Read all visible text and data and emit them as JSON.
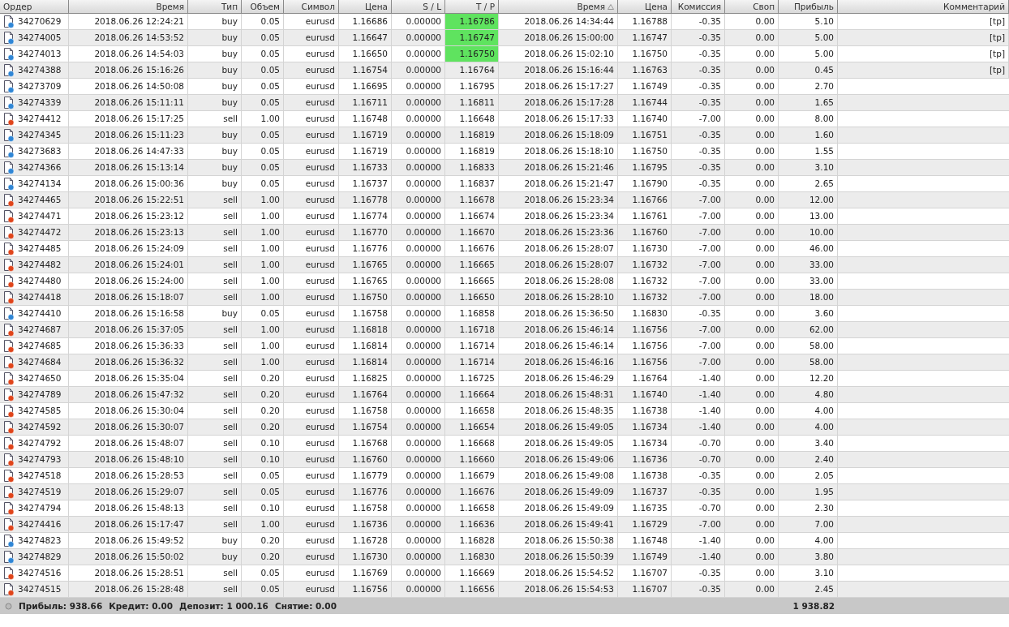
{
  "columns": [
    {
      "label": "Ордер",
      "sorted": false
    },
    {
      "label": "Время",
      "sorted": false
    },
    {
      "label": "Тип",
      "sorted": false
    },
    {
      "label": "Объем",
      "sorted": false
    },
    {
      "label": "Символ",
      "sorted": false
    },
    {
      "label": "Цена",
      "sorted": false
    },
    {
      "label": "S / L",
      "sorted": false
    },
    {
      "label": "T / P",
      "sorted": false
    },
    {
      "label": "Время",
      "sorted": true
    },
    {
      "label": "Цена",
      "sorted": false
    },
    {
      "label": "Комиссия",
      "sorted": false
    },
    {
      "label": "Своп",
      "sorted": false
    },
    {
      "label": "Прибыль",
      "sorted": false
    },
    {
      "label": "Комментарий",
      "sorted": false
    }
  ],
  "rows": [
    {
      "kind": "buy",
      "tp_hit": true,
      "cells": [
        "34270629",
        "2018.06.26 12:24:21",
        "buy",
        "0.05",
        "eurusd",
        "1.16686",
        "0.00000",
        "1.16786",
        "2018.06.26 14:34:44",
        "1.16788",
        "-0.35",
        "0.00",
        "5.10",
        "[tp]"
      ]
    },
    {
      "kind": "buy",
      "tp_hit": true,
      "cells": [
        "34274005",
        "2018.06.26 14:53:52",
        "buy",
        "0.05",
        "eurusd",
        "1.16647",
        "0.00000",
        "1.16747",
        "2018.06.26 15:00:00",
        "1.16747",
        "-0.35",
        "0.00",
        "5.00",
        "[tp]"
      ]
    },
    {
      "kind": "buy",
      "tp_hit": true,
      "cells": [
        "34274013",
        "2018.06.26 14:54:03",
        "buy",
        "0.05",
        "eurusd",
        "1.16650",
        "0.00000",
        "1.16750",
        "2018.06.26 15:02:10",
        "1.16750",
        "-0.35",
        "0.00",
        "5.00",
        "[tp]"
      ]
    },
    {
      "kind": "buy",
      "tp_hit": false,
      "cells": [
        "34274388",
        "2018.06.26 15:16:26",
        "buy",
        "0.05",
        "eurusd",
        "1.16754",
        "0.00000",
        "1.16764",
        "2018.06.26 15:16:44",
        "1.16763",
        "-0.35",
        "0.00",
        "0.45",
        "[tp]"
      ]
    },
    {
      "kind": "buy",
      "tp_hit": false,
      "cells": [
        "34273709",
        "2018.06.26 14:50:08",
        "buy",
        "0.05",
        "eurusd",
        "1.16695",
        "0.00000",
        "1.16795",
        "2018.06.26 15:17:27",
        "1.16749",
        "-0.35",
        "0.00",
        "2.70"
      ]
    },
    {
      "kind": "buy",
      "tp_hit": false,
      "cells": [
        "34274339",
        "2018.06.26 15:11:11",
        "buy",
        "0.05",
        "eurusd",
        "1.16711",
        "0.00000",
        "1.16811",
        "2018.06.26 15:17:28",
        "1.16744",
        "-0.35",
        "0.00",
        "1.65"
      ]
    },
    {
      "kind": "sell",
      "tp_hit": false,
      "cells": [
        "34274412",
        "2018.06.26 15:17:25",
        "sell",
        "1.00",
        "eurusd",
        "1.16748",
        "0.00000",
        "1.16648",
        "2018.06.26 15:17:33",
        "1.16740",
        "-7.00",
        "0.00",
        "8.00"
      ]
    },
    {
      "kind": "buy",
      "tp_hit": false,
      "cells": [
        "34274345",
        "2018.06.26 15:11:23",
        "buy",
        "0.05",
        "eurusd",
        "1.16719",
        "0.00000",
        "1.16819",
        "2018.06.26 15:18:09",
        "1.16751",
        "-0.35",
        "0.00",
        "1.60"
      ]
    },
    {
      "kind": "buy",
      "tp_hit": false,
      "cells": [
        "34273683",
        "2018.06.26 14:47:33",
        "buy",
        "0.05",
        "eurusd",
        "1.16719",
        "0.00000",
        "1.16819",
        "2018.06.26 15:18:10",
        "1.16750",
        "-0.35",
        "0.00",
        "1.55"
      ]
    },
    {
      "kind": "buy",
      "tp_hit": false,
      "cells": [
        "34274366",
        "2018.06.26 15:13:14",
        "buy",
        "0.05",
        "eurusd",
        "1.16733",
        "0.00000",
        "1.16833",
        "2018.06.26 15:21:46",
        "1.16795",
        "-0.35",
        "0.00",
        "3.10"
      ]
    },
    {
      "kind": "buy",
      "tp_hit": false,
      "cells": [
        "34274134",
        "2018.06.26 15:00:36",
        "buy",
        "0.05",
        "eurusd",
        "1.16737",
        "0.00000",
        "1.16837",
        "2018.06.26 15:21:47",
        "1.16790",
        "-0.35",
        "0.00",
        "2.65"
      ]
    },
    {
      "kind": "sell",
      "tp_hit": false,
      "cells": [
        "34274465",
        "2018.06.26 15:22:51",
        "sell",
        "1.00",
        "eurusd",
        "1.16778",
        "0.00000",
        "1.16678",
        "2018.06.26 15:23:34",
        "1.16766",
        "-7.00",
        "0.00",
        "12.00"
      ]
    },
    {
      "kind": "sell",
      "tp_hit": false,
      "cells": [
        "34274471",
        "2018.06.26 15:23:12",
        "sell",
        "1.00",
        "eurusd",
        "1.16774",
        "0.00000",
        "1.16674",
        "2018.06.26 15:23:34",
        "1.16761",
        "-7.00",
        "0.00",
        "13.00"
      ]
    },
    {
      "kind": "sell",
      "tp_hit": false,
      "cells": [
        "34274472",
        "2018.06.26 15:23:13",
        "sell",
        "1.00",
        "eurusd",
        "1.16770",
        "0.00000",
        "1.16670",
        "2018.06.26 15:23:36",
        "1.16760",
        "-7.00",
        "0.00",
        "10.00"
      ]
    },
    {
      "kind": "sell",
      "tp_hit": false,
      "cells": [
        "34274485",
        "2018.06.26 15:24:09",
        "sell",
        "1.00",
        "eurusd",
        "1.16776",
        "0.00000",
        "1.16676",
        "2018.06.26 15:28:07",
        "1.16730",
        "-7.00",
        "0.00",
        "46.00"
      ]
    },
    {
      "kind": "sell",
      "tp_hit": false,
      "cells": [
        "34274482",
        "2018.06.26 15:24:01",
        "sell",
        "1.00",
        "eurusd",
        "1.16765",
        "0.00000",
        "1.16665",
        "2018.06.26 15:28:07",
        "1.16732",
        "-7.00",
        "0.00",
        "33.00"
      ]
    },
    {
      "kind": "sell",
      "tp_hit": false,
      "cells": [
        "34274480",
        "2018.06.26 15:24:00",
        "sell",
        "1.00",
        "eurusd",
        "1.16765",
        "0.00000",
        "1.16665",
        "2018.06.26 15:28:08",
        "1.16732",
        "-7.00",
        "0.00",
        "33.00"
      ]
    },
    {
      "kind": "sell",
      "tp_hit": false,
      "cells": [
        "34274418",
        "2018.06.26 15:18:07",
        "sell",
        "1.00",
        "eurusd",
        "1.16750",
        "0.00000",
        "1.16650",
        "2018.06.26 15:28:10",
        "1.16732",
        "-7.00",
        "0.00",
        "18.00"
      ]
    },
    {
      "kind": "buy",
      "tp_hit": false,
      "cells": [
        "34274410",
        "2018.06.26 15:16:58",
        "buy",
        "0.05",
        "eurusd",
        "1.16758",
        "0.00000",
        "1.16858",
        "2018.06.26 15:36:50",
        "1.16830",
        "-0.35",
        "0.00",
        "3.60"
      ]
    },
    {
      "kind": "sell",
      "tp_hit": false,
      "cells": [
        "34274687",
        "2018.06.26 15:37:05",
        "sell",
        "1.00",
        "eurusd",
        "1.16818",
        "0.00000",
        "1.16718",
        "2018.06.26 15:46:14",
        "1.16756",
        "-7.00",
        "0.00",
        "62.00"
      ]
    },
    {
      "kind": "sell",
      "tp_hit": false,
      "cells": [
        "34274685",
        "2018.06.26 15:36:33",
        "sell",
        "1.00",
        "eurusd",
        "1.16814",
        "0.00000",
        "1.16714",
        "2018.06.26 15:46:14",
        "1.16756",
        "-7.00",
        "0.00",
        "58.00"
      ]
    },
    {
      "kind": "sell",
      "tp_hit": false,
      "cells": [
        "34274684",
        "2018.06.26 15:36:32",
        "sell",
        "1.00",
        "eurusd",
        "1.16814",
        "0.00000",
        "1.16714",
        "2018.06.26 15:46:16",
        "1.16756",
        "-7.00",
        "0.00",
        "58.00"
      ]
    },
    {
      "kind": "sell",
      "tp_hit": false,
      "cells": [
        "34274650",
        "2018.06.26 15:35:04",
        "sell",
        "0.20",
        "eurusd",
        "1.16825",
        "0.00000",
        "1.16725",
        "2018.06.26 15:46:29",
        "1.16764",
        "-1.40",
        "0.00",
        "12.20"
      ]
    },
    {
      "kind": "sell",
      "tp_hit": false,
      "cells": [
        "34274789",
        "2018.06.26 15:47:32",
        "sell",
        "0.20",
        "eurusd",
        "1.16764",
        "0.00000",
        "1.16664",
        "2018.06.26 15:48:31",
        "1.16740",
        "-1.40",
        "0.00",
        "4.80"
      ]
    },
    {
      "kind": "sell",
      "tp_hit": false,
      "cells": [
        "34274585",
        "2018.06.26 15:30:04",
        "sell",
        "0.20",
        "eurusd",
        "1.16758",
        "0.00000",
        "1.16658",
        "2018.06.26 15:48:35",
        "1.16738",
        "-1.40",
        "0.00",
        "4.00"
      ]
    },
    {
      "kind": "sell",
      "tp_hit": false,
      "cells": [
        "34274592",
        "2018.06.26 15:30:07",
        "sell",
        "0.20",
        "eurusd",
        "1.16754",
        "0.00000",
        "1.16654",
        "2018.06.26 15:49:05",
        "1.16734",
        "-1.40",
        "0.00",
        "4.00"
      ]
    },
    {
      "kind": "sell",
      "tp_hit": false,
      "cells": [
        "34274792",
        "2018.06.26 15:48:07",
        "sell",
        "0.10",
        "eurusd",
        "1.16768",
        "0.00000",
        "1.16668",
        "2018.06.26 15:49:05",
        "1.16734",
        "-0.70",
        "0.00",
        "3.40"
      ]
    },
    {
      "kind": "sell",
      "tp_hit": false,
      "cells": [
        "34274793",
        "2018.06.26 15:48:10",
        "sell",
        "0.10",
        "eurusd",
        "1.16760",
        "0.00000",
        "1.16660",
        "2018.06.26 15:49:06",
        "1.16736",
        "-0.70",
        "0.00",
        "2.40"
      ]
    },
    {
      "kind": "sell",
      "tp_hit": false,
      "cells": [
        "34274518",
        "2018.06.26 15:28:53",
        "sell",
        "0.05",
        "eurusd",
        "1.16779",
        "0.00000",
        "1.16679",
        "2018.06.26 15:49:08",
        "1.16738",
        "-0.35",
        "0.00",
        "2.05"
      ]
    },
    {
      "kind": "sell",
      "tp_hit": false,
      "cells": [
        "34274519",
        "2018.06.26 15:29:07",
        "sell",
        "0.05",
        "eurusd",
        "1.16776",
        "0.00000",
        "1.16676",
        "2018.06.26 15:49:09",
        "1.16737",
        "-0.35",
        "0.00",
        "1.95"
      ]
    },
    {
      "kind": "sell",
      "tp_hit": false,
      "cells": [
        "34274794",
        "2018.06.26 15:48:13",
        "sell",
        "0.10",
        "eurusd",
        "1.16758",
        "0.00000",
        "1.16658",
        "2018.06.26 15:49:09",
        "1.16735",
        "-0.70",
        "0.00",
        "2.30"
      ]
    },
    {
      "kind": "sell",
      "tp_hit": false,
      "cells": [
        "34274416",
        "2018.06.26 15:17:47",
        "sell",
        "1.00",
        "eurusd",
        "1.16736",
        "0.00000",
        "1.16636",
        "2018.06.26 15:49:41",
        "1.16729",
        "-7.00",
        "0.00",
        "7.00"
      ]
    },
    {
      "kind": "buy",
      "tp_hit": false,
      "cells": [
        "34274823",
        "2018.06.26 15:49:52",
        "buy",
        "0.20",
        "eurusd",
        "1.16728",
        "0.00000",
        "1.16828",
        "2018.06.26 15:50:38",
        "1.16748",
        "-1.40",
        "0.00",
        "4.00"
      ]
    },
    {
      "kind": "buy",
      "tp_hit": false,
      "cells": [
        "34274829",
        "2018.06.26 15:50:02",
        "buy",
        "0.20",
        "eurusd",
        "1.16730",
        "0.00000",
        "1.16830",
        "2018.06.26 15:50:39",
        "1.16749",
        "-1.40",
        "0.00",
        "3.80"
      ]
    },
    {
      "kind": "sell",
      "tp_hit": false,
      "cells": [
        "34274516",
        "2018.06.26 15:28:51",
        "sell",
        "0.05",
        "eurusd",
        "1.16769",
        "0.00000",
        "1.16669",
        "2018.06.26 15:54:52",
        "1.16707",
        "-0.35",
        "0.00",
        "3.10"
      ]
    },
    {
      "kind": "sell",
      "tp_hit": false,
      "cells": [
        "34274515",
        "2018.06.26 15:28:48",
        "sell",
        "0.05",
        "eurusd",
        "1.16756",
        "0.00000",
        "1.16656",
        "2018.06.26 15:54:53",
        "1.16707",
        "-0.35",
        "0.00",
        "2.45"
      ]
    }
  ],
  "summary": {
    "items": [
      "Прибыль: 938.66",
      "Кредит: 0.00",
      "Депозит: 1 000.16",
      "Снятие: 0.00"
    ],
    "total": "1 938.82"
  }
}
